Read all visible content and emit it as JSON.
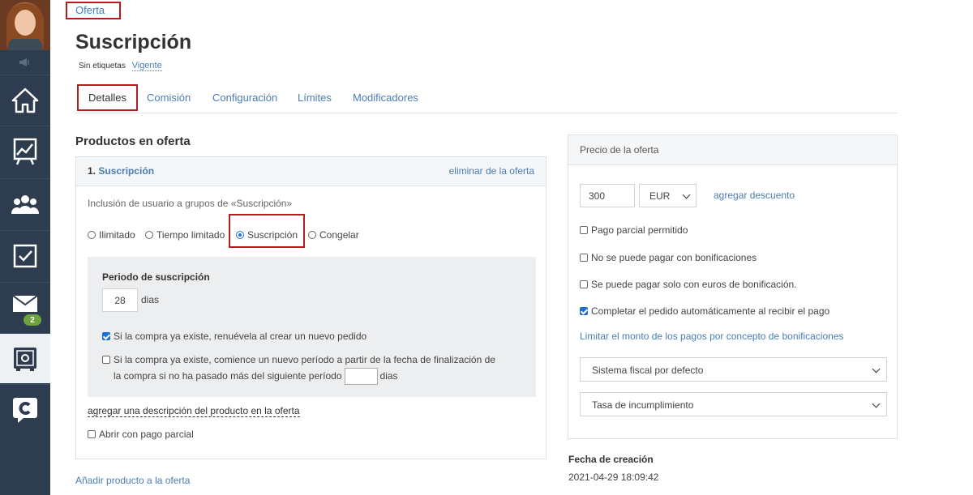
{
  "sidebar": {
    "badge_count": "2",
    "items": [
      {
        "icon": "home-icon"
      },
      {
        "icon": "chart-icon"
      },
      {
        "icon": "users-icon"
      },
      {
        "icon": "checkbox-icon"
      },
      {
        "icon": "mail-icon"
      },
      {
        "icon": "safe-icon"
      },
      {
        "icon": "chat-icon"
      }
    ]
  },
  "header": {
    "breadcrumb": "Oferta",
    "title": "Suscripción",
    "no_tags": "Sin etiquetas",
    "status": "Vigente"
  },
  "tabs": [
    "Detalles",
    "Comisión",
    "Configuración",
    "Límites",
    "Modificadores"
  ],
  "products": {
    "section_title": "Productos en oferta",
    "item_number": "1.",
    "item_name": "Suscripción",
    "remove_label": "eliminar de la oferta",
    "inclusion_text": "Inclusión de usuario a grupos de «Suscripción»",
    "radio_options": [
      "Ilimitado",
      "Tiempo limitado",
      "Suscripción",
      "Congelar"
    ],
    "radio_selected": "Suscripción",
    "period_title": "Periodo de suscripción",
    "period_value": "28",
    "period_unit": "dias",
    "renew_label": "Si la compra ya existe, renuévela al crear un nuevo pedido",
    "renew_checked": true,
    "new_period_line1": "Si la compra ya existe, comience un nuevo período a partir de la fecha de finalización de",
    "new_period_line2": "la compra si no ha pasado más del siguiente período",
    "new_period_unit": "dias",
    "new_period_checked": false,
    "add_description": "agregar una descripción del producto en la oferta",
    "open_partial": "Abrir con pago parcial",
    "add_product": "Añadir producto a la oferta"
  },
  "price": {
    "header": "Precio de la oferta",
    "amount": "300",
    "currency": "EUR",
    "add_discount": "agregar descuento",
    "options": [
      {
        "label": "Pago parcial permitido",
        "checked": false
      },
      {
        "label": "No se puede pagar con bonificaciones",
        "checked": false
      },
      {
        "label": "Se puede pagar solo con euros de bonificación.",
        "checked": false
      },
      {
        "label": "Completar el pedido automáticamente al recibir el pago",
        "checked": true
      }
    ],
    "limit_link": "Limitar el monto de los pagos por concepto de bonificaciones",
    "tax_system": "Sistema fiscal por defecto",
    "default_rate": "Tasa de incumplimiento"
  },
  "created": {
    "label": "Fecha de creación",
    "value": "2021-04-29 18:09:42"
  },
  "colors": {
    "sidebar_bg": "#2d3c4f",
    "link": "#4a7db4",
    "highlight": "#b71c1c",
    "badge": "#6da341"
  }
}
